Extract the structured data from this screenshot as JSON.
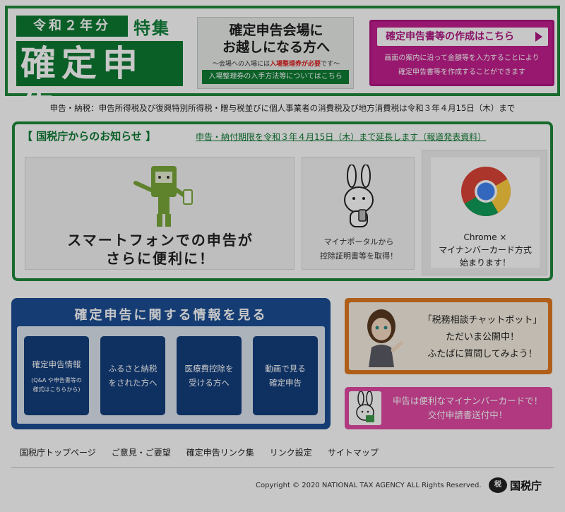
{
  "header": {
    "year_badge": "令和２年分",
    "tokushu": "特集",
    "kakutei": "確定申告",
    "venue": {
      "title_line1": "確定申告会場に",
      "title_line2": "お越しになる方へ",
      "note_prefix": "〜会場への入場には",
      "note_red": "入場整理券が必要",
      "note_suffix": "です〜",
      "link": "入場整理券の入手方法等についてはこちら"
    },
    "create": {
      "button": "確定申告書等の作成はこちら",
      "desc_line1": "画面の案内に沿って金額等を入力することにより",
      "desc_line2": "確定申告書等を作成することができます"
    }
  },
  "deadline_text": "申告・納税：申告所得税及び復興特別所得税・贈与税並びに個人事業者の消費税及び地方消費税は令和３年４月15日（木）まで",
  "notice": {
    "title": "【 国税庁からのお知らせ 】",
    "link": "申告・納付期限を令和３年４月15日（木）まで延長します（報道発表資料）",
    "smartphone": {
      "line1": "スマートフォンでの申告が",
      "line2": "さらに便利に！"
    },
    "portal": {
      "line1": "マイナポータルから",
      "line2": "控除証明書等を取得！"
    },
    "chrome": {
      "line1": "Chrome ×",
      "line2": "マイナンバーカード方式",
      "line3": "始まります！"
    }
  },
  "info": {
    "title": "確定申告に関する情報を見る",
    "tiles": [
      {
        "line1": "確定申告情報",
        "line2": "",
        "small1": "(Q&A や申告書等の",
        "small2": "様式はこちらから)"
      },
      {
        "line1": "ふるさと納税",
        "line2": "をされた方へ",
        "small1": "",
        "small2": ""
      },
      {
        "line1": "医療費控除を",
        "line2": "受ける方へ",
        "small1": "",
        "small2": ""
      },
      {
        "line1": "動画で見る",
        "line2": "確定申告",
        "small1": "",
        "small2": ""
      }
    ]
  },
  "chatbot": {
    "line1": "「税務相談チャットボット」",
    "line2": "ただいま公開中！",
    "line3": "ふたばに質問してみよう！"
  },
  "mynumber": {
    "line1": "申告は便利なマイナンバーカードで！",
    "line2": "交付申請書送付中！"
  },
  "footer": {
    "links": [
      "国税庁トップページ",
      "ご意見・ご要望",
      "確定申告リンク集",
      "リンク設定",
      "サイトマップ"
    ],
    "copyright": "Copyright © 2020 NATIONAL TAX AGENCY ALL Rights Reserved.",
    "logo_text": "国税庁",
    "logo_mark": "税"
  },
  "colors": {
    "green": "#0e7a33",
    "magenta": "#c21f8e",
    "navy": "#1c4f95",
    "orange": "#e07a22",
    "pink": "#e24aa4"
  }
}
